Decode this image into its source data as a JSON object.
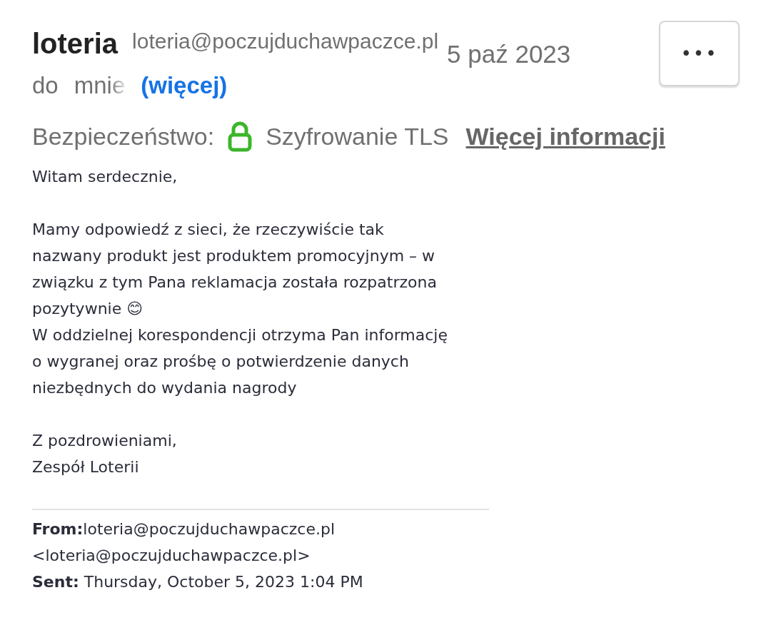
{
  "header": {
    "sender_name": "loteria",
    "sender_email": "loteria@poczujduchawpaczce.pl",
    "date": "5 paź 2023",
    "menu_button": "•••"
  },
  "recipients": {
    "prefix": "do",
    "name": "mnie",
    "more_link": "(więcej)"
  },
  "security": {
    "label": "Bezpieczeństwo:",
    "encryption": "Szyfrowanie TLS",
    "link": "Więcej informacji"
  },
  "body": [
    "Witam serdecznie,",
    "Mamy odpowiedź z sieci, że rzeczywiście tak\nnazwany produkt jest produktem promocyjnym – w\nzwiązku z tym Pana reklamacja została rozpatrzona\npozytywnie 😊\nW oddzielnej korespondencji otrzyma Pan informację\no wygranej oraz prośbę o potwierdzenie danych\nniezbędnych do wydania nagrody",
    "Z pozdrowieniami,\nZespół Loterii"
  ],
  "quoted_header": [
    "**From:**loteria@poczujduchawpaczce.pl",
    "<loteria@poczujduchawpaczce.pl>",
    "**Sent:** Thursday, October 5, 2023 1:04 PM"
  ]
}
